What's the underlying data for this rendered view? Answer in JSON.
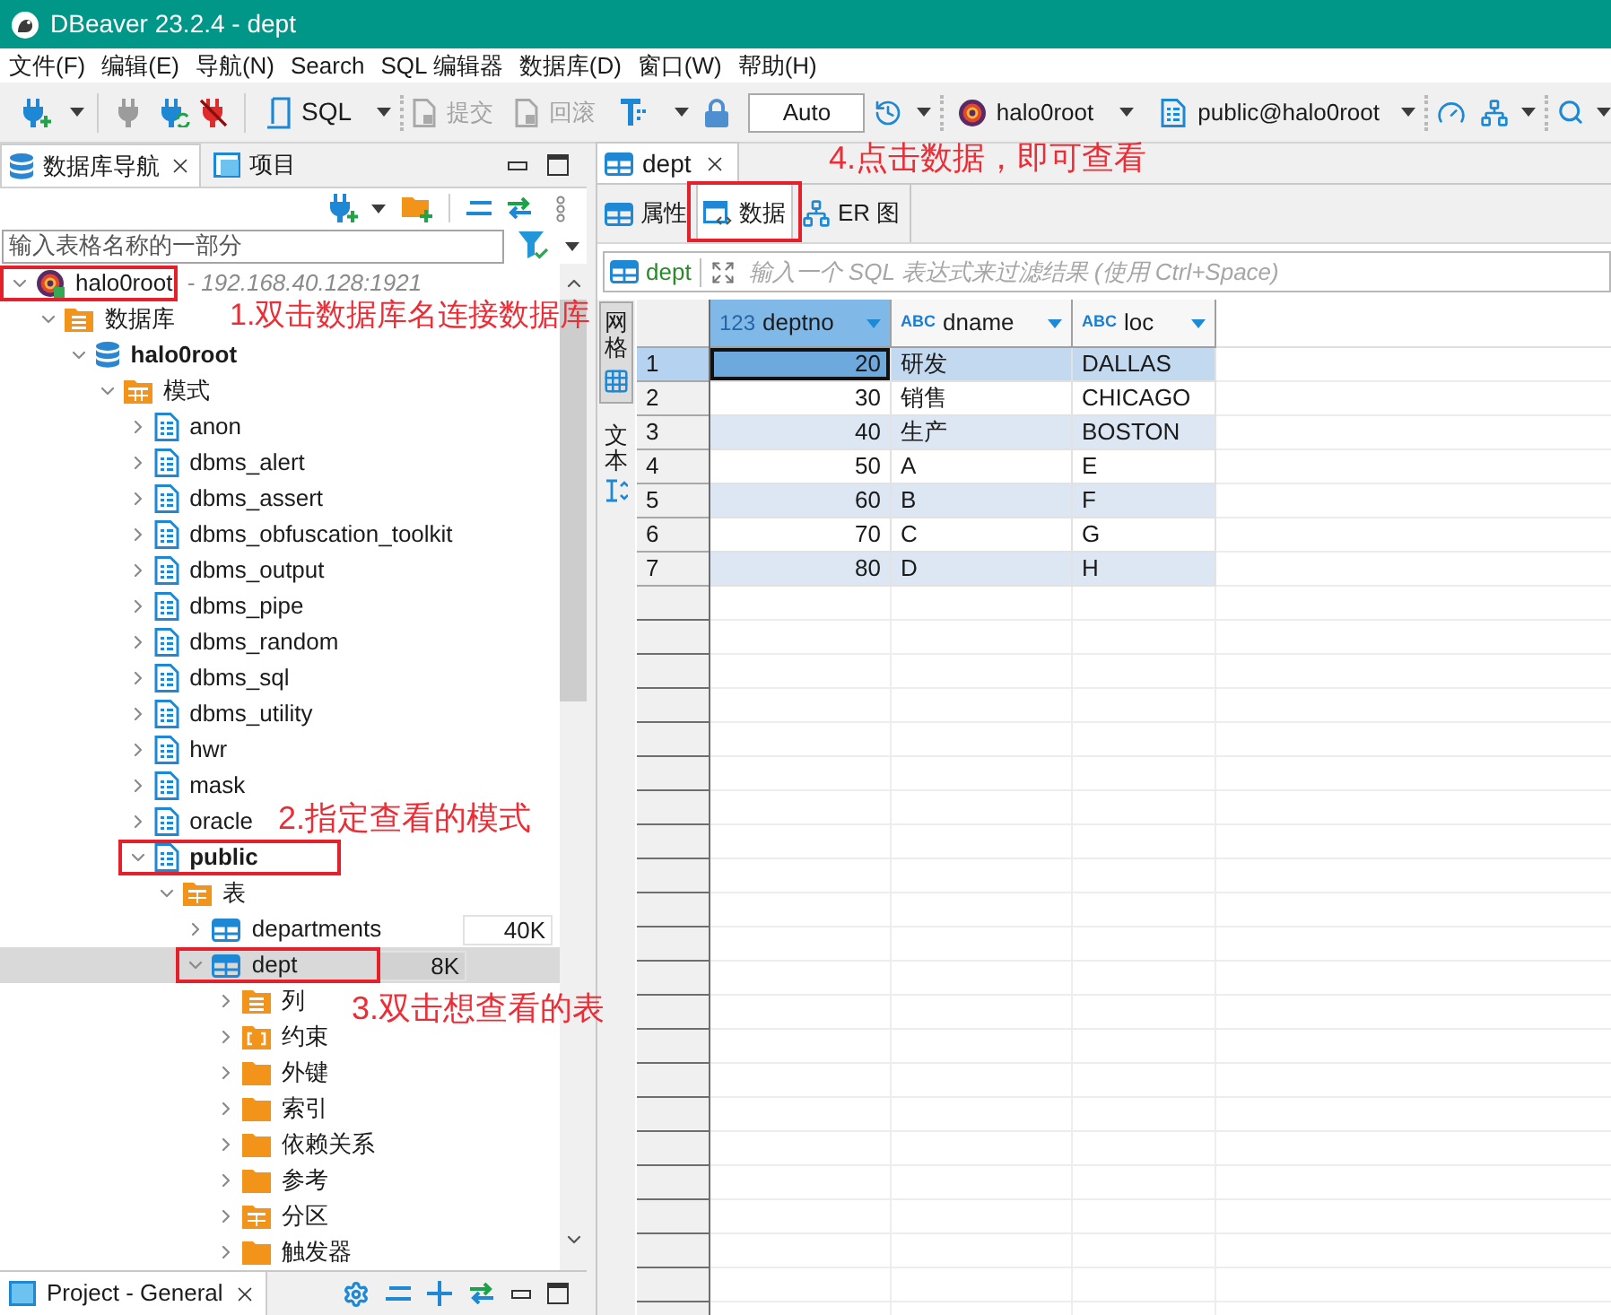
{
  "window": {
    "title": "DBeaver 23.2.4 - dept"
  },
  "menu": [
    "文件(F)",
    "编辑(E)",
    "导航(N)",
    "Search",
    "SQL 编辑器",
    "数据库(D)",
    "窗口(W)",
    "帮助(H)"
  ],
  "toolbar": {
    "sql": "SQL",
    "commit": {
      "label": "提交",
      "disabled": true
    },
    "rollback": {
      "label": "回滚",
      "disabled": true
    },
    "transaction_mode": "Auto",
    "connection": "halo0root",
    "schema": "public@halo0root"
  },
  "navigator": {
    "tabs": [
      {
        "label": "数据库导航",
        "selected": true
      },
      {
        "label": "项目",
        "selected": false
      }
    ],
    "filter": {
      "placeholder": "输入表格名称的一部分"
    },
    "tree": [
      {
        "kind": "connection",
        "label": "halo0root",
        "detail": "- 192.168.40.128:1921",
        "expanded": true,
        "marked": true,
        "children": [
          {
            "kind": "databases",
            "label": "数据库",
            "expanded": true,
            "marked": false,
            "children": [
              {
                "kind": "database",
                "label": "halo0root",
                "bold": true,
                "expanded": true,
                "marked": false,
                "children": [
                  {
                    "kind": "schemas",
                    "label": "模式",
                    "expanded": true,
                    "marked": false,
                    "children": [
                      {
                        "kind": "schema",
                        "label": "anon",
                        "bold": false,
                        "expanded": false,
                        "marked": false
                      },
                      {
                        "kind": "schema",
                        "label": "dbms_alert",
                        "bold": false,
                        "expanded": false,
                        "marked": false
                      },
                      {
                        "kind": "schema",
                        "label": "dbms_assert",
                        "bold": false,
                        "expanded": false,
                        "marked": false
                      },
                      {
                        "kind": "schema",
                        "label": "dbms_obfuscation_toolkit",
                        "bold": false,
                        "expanded": false,
                        "marked": false
                      },
                      {
                        "kind": "schema",
                        "label": "dbms_output",
                        "bold": false,
                        "expanded": false,
                        "marked": false
                      },
                      {
                        "kind": "schema",
                        "label": "dbms_pipe",
                        "bold": false,
                        "expanded": false,
                        "marked": false
                      },
                      {
                        "kind": "schema",
                        "label": "dbms_random",
                        "bold": false,
                        "expanded": false,
                        "marked": false
                      },
                      {
                        "kind": "schema",
                        "label": "dbms_sql",
                        "bold": false,
                        "expanded": false,
                        "marked": false
                      },
                      {
                        "kind": "schema",
                        "label": "dbms_utility",
                        "bold": false,
                        "expanded": false,
                        "marked": false
                      },
                      {
                        "kind": "schema",
                        "label": "hwr",
                        "bold": false,
                        "expanded": false,
                        "marked": false
                      },
                      {
                        "kind": "schema",
                        "label": "mask",
                        "bold": false,
                        "expanded": false,
                        "marked": false
                      },
                      {
                        "kind": "schema",
                        "label": "oracle",
                        "bold": false,
                        "expanded": false,
                        "marked": false
                      },
                      {
                        "kind": "schema",
                        "label": "public",
                        "bold": true,
                        "expanded": true,
                        "marked": true,
                        "children": [
                          {
                            "kind": "tables",
                            "label": "表",
                            "expanded": true,
                            "marked": false,
                            "children": [
                              {
                                "kind": "table",
                                "label": "departments",
                                "size": "40K",
                                "selected": false,
                                "expanded": false,
                                "marked": false
                              },
                              {
                                "kind": "table",
                                "label": "dept",
                                "size": "8K",
                                "selected": true,
                                "expanded": true,
                                "marked": true,
                                "children": [
                                  {
                                    "kind": "columns",
                                    "label": "列",
                                    "expanded": false,
                                    "marked": false
                                  },
                                  {
                                    "kind": "constraints",
                                    "label": "约束",
                                    "expanded": false,
                                    "marked": false
                                  },
                                  {
                                    "kind": "folder",
                                    "label": "外键",
                                    "expanded": false,
                                    "marked": false
                                  },
                                  {
                                    "kind": "folder",
                                    "label": "索引",
                                    "expanded": false,
                                    "marked": false
                                  },
                                  {
                                    "kind": "folder",
                                    "label": "依赖关系",
                                    "expanded": false,
                                    "marked": false
                                  },
                                  {
                                    "kind": "folder",
                                    "label": "参考",
                                    "expanded": false,
                                    "marked": false
                                  },
                                  {
                                    "kind": "partitions",
                                    "label": "分区",
                                    "expanded": false,
                                    "marked": false
                                  },
                                  {
                                    "kind": "folder",
                                    "label": "触发器",
                                    "expanded": false,
                                    "marked": false
                                  }
                                ]
                              }
                            ]
                          }
                        ]
                      }
                    ]
                  }
                ]
              }
            ]
          }
        ]
      }
    ]
  },
  "project_panel": {
    "tab": "Project - General"
  },
  "editor": {
    "tab": "dept",
    "subtabs": [
      {
        "label": "属性",
        "kind": "properties",
        "selected": false,
        "marked": false
      },
      {
        "label": "数据",
        "kind": "data",
        "selected": true,
        "marked": true
      },
      {
        "label": "ER 图",
        "kind": "diagram",
        "selected": false,
        "marked": false
      }
    ],
    "filter": {
      "table": "dept",
      "placeholder": "输入一个 SQL 表达式来过滤结果 (使用 Ctrl+Space)"
    },
    "view_tabs": [
      {
        "label": "网格",
        "kind": "grid",
        "selected": true
      },
      {
        "label": "文本",
        "kind": "text",
        "selected": false
      }
    ],
    "grid": {
      "columns": [
        {
          "name": "deptno",
          "type": "123",
          "kind": "number",
          "selected": true
        },
        {
          "name": "dname",
          "type": "ABC",
          "kind": "text",
          "selected": false
        },
        {
          "name": "loc",
          "type": "ABC",
          "kind": "text",
          "selected": false
        }
      ],
      "rows": [
        {
          "number": "1",
          "cells": [
            "20",
            "研发",
            "DALLAS"
          ],
          "selected": true
        },
        {
          "number": "2",
          "cells": [
            "30",
            "销售",
            "CHICAGO"
          ],
          "selected": false
        },
        {
          "number": "3",
          "cells": [
            "40",
            "生产",
            "BOSTON"
          ],
          "selected": false
        },
        {
          "number": "4",
          "cells": [
            "50",
            "A",
            "E"
          ],
          "selected": false
        },
        {
          "number": "5",
          "cells": [
            "60",
            "B",
            "F"
          ],
          "selected": false
        },
        {
          "number": "6",
          "cells": [
            "70",
            "C",
            "G"
          ],
          "selected": false
        },
        {
          "number": "7",
          "cells": [
            "80",
            "D",
            "H"
          ],
          "selected": false
        }
      ]
    }
  },
  "annotations": [
    {
      "text": "1.双击数据库名连接数据库"
    },
    {
      "text": "2.指定查看的模式"
    },
    {
      "text": "3.双击想查看的表"
    },
    {
      "text": "4.点击数据，即可查看"
    }
  ]
}
